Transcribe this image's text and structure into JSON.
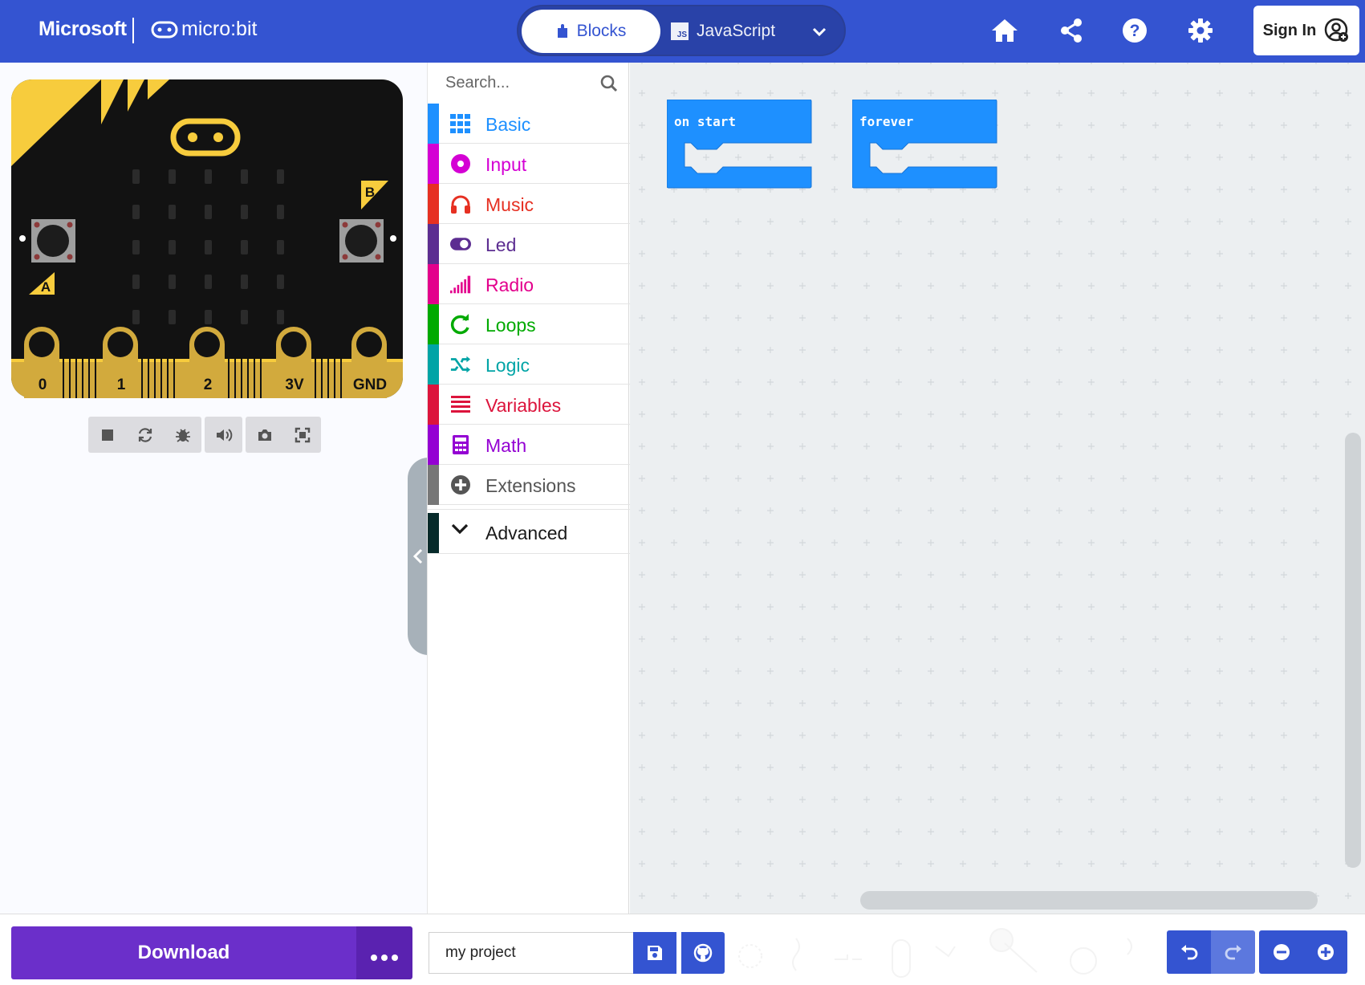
{
  "header": {
    "microsoft_label": "Microsoft",
    "microbit_label": "micro:bit",
    "tabs": [
      {
        "label": "Blocks",
        "active": true
      },
      {
        "label": "JavaScript",
        "active": false,
        "badge": "JS"
      }
    ],
    "icons": [
      "home-icon",
      "share-icon",
      "help-icon",
      "settings-icon"
    ],
    "sign_in_label": "Sign In",
    "bg_color": "#3454d1"
  },
  "simulator": {
    "pins": [
      "0",
      "1",
      "2",
      "3V",
      "GND"
    ],
    "button_a": "A",
    "button_b": "B",
    "toolbar_icons": [
      "stop-icon",
      "restart-icon",
      "debug-icon",
      "sound-icon",
      "screenshot-icon",
      "fullscreen-icon"
    ]
  },
  "toolbox": {
    "search_placeholder": "Search...",
    "categories": [
      {
        "label": "Basic",
        "color": "#1e90ff",
        "icon": "grid-icon"
      },
      {
        "label": "Input",
        "color": "#d400d4",
        "icon": "input-circle-icon"
      },
      {
        "label": "Music",
        "color": "#e63022",
        "icon": "headphones-icon"
      },
      {
        "label": "Led",
        "color": "#5c2d91",
        "icon": "toggle-icon"
      },
      {
        "label": "Radio",
        "color": "#e3008c",
        "icon": "signal-bars-icon"
      },
      {
        "label": "Loops",
        "color": "#00aa00",
        "icon": "loop-arrow-icon"
      },
      {
        "label": "Logic",
        "color": "#00a4a6",
        "icon": "shuffle-icon"
      },
      {
        "label": "Variables",
        "color": "#dc143c",
        "icon": "lines-icon"
      },
      {
        "label": "Math",
        "color": "#9400d3",
        "icon": "calculator-icon"
      },
      {
        "label": "Extensions",
        "color": "#555555",
        "icon": "plus-circle-icon"
      }
    ],
    "advanced_label": "Advanced"
  },
  "workspace": {
    "blocks": [
      {
        "label": "on start"
      },
      {
        "label": "forever"
      }
    ],
    "block_color": "#1e90ff"
  },
  "bottom": {
    "download_label": "Download",
    "project_name": "my project",
    "download_color": "#6b2fca"
  }
}
